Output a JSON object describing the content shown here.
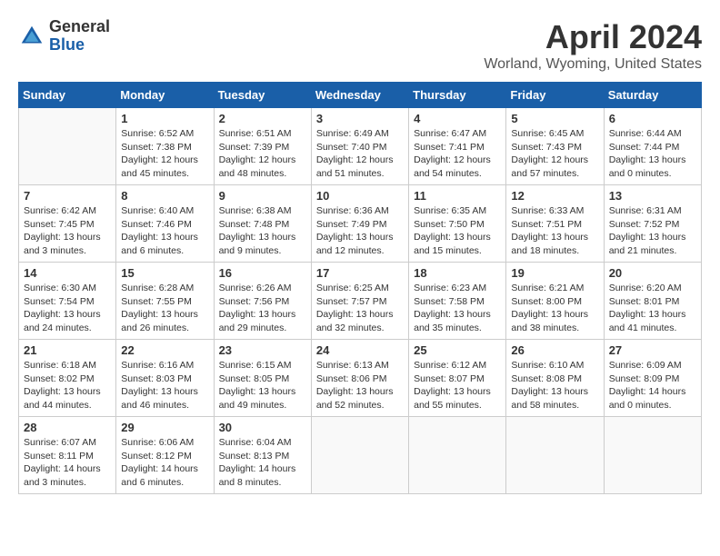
{
  "header": {
    "logo": {
      "line1": "General",
      "line2": "Blue"
    },
    "title": "April 2024",
    "subtitle": "Worland, Wyoming, United States"
  },
  "calendar": {
    "days_of_week": [
      "Sunday",
      "Monday",
      "Tuesday",
      "Wednesday",
      "Thursday",
      "Friday",
      "Saturday"
    ],
    "weeks": [
      [
        {
          "day": "",
          "info": ""
        },
        {
          "day": "1",
          "info": "Sunrise: 6:52 AM\nSunset: 7:38 PM\nDaylight: 12 hours\nand 45 minutes."
        },
        {
          "day": "2",
          "info": "Sunrise: 6:51 AM\nSunset: 7:39 PM\nDaylight: 12 hours\nand 48 minutes."
        },
        {
          "day": "3",
          "info": "Sunrise: 6:49 AM\nSunset: 7:40 PM\nDaylight: 12 hours\nand 51 minutes."
        },
        {
          "day": "4",
          "info": "Sunrise: 6:47 AM\nSunset: 7:41 PM\nDaylight: 12 hours\nand 54 minutes."
        },
        {
          "day": "5",
          "info": "Sunrise: 6:45 AM\nSunset: 7:43 PM\nDaylight: 12 hours\nand 57 minutes."
        },
        {
          "day": "6",
          "info": "Sunrise: 6:44 AM\nSunset: 7:44 PM\nDaylight: 13 hours\nand 0 minutes."
        }
      ],
      [
        {
          "day": "7",
          "info": "Sunrise: 6:42 AM\nSunset: 7:45 PM\nDaylight: 13 hours\nand 3 minutes."
        },
        {
          "day": "8",
          "info": "Sunrise: 6:40 AM\nSunset: 7:46 PM\nDaylight: 13 hours\nand 6 minutes."
        },
        {
          "day": "9",
          "info": "Sunrise: 6:38 AM\nSunset: 7:48 PM\nDaylight: 13 hours\nand 9 minutes."
        },
        {
          "day": "10",
          "info": "Sunrise: 6:36 AM\nSunset: 7:49 PM\nDaylight: 13 hours\nand 12 minutes."
        },
        {
          "day": "11",
          "info": "Sunrise: 6:35 AM\nSunset: 7:50 PM\nDaylight: 13 hours\nand 15 minutes."
        },
        {
          "day": "12",
          "info": "Sunrise: 6:33 AM\nSunset: 7:51 PM\nDaylight: 13 hours\nand 18 minutes."
        },
        {
          "day": "13",
          "info": "Sunrise: 6:31 AM\nSunset: 7:52 PM\nDaylight: 13 hours\nand 21 minutes."
        }
      ],
      [
        {
          "day": "14",
          "info": "Sunrise: 6:30 AM\nSunset: 7:54 PM\nDaylight: 13 hours\nand 24 minutes."
        },
        {
          "day": "15",
          "info": "Sunrise: 6:28 AM\nSunset: 7:55 PM\nDaylight: 13 hours\nand 26 minutes."
        },
        {
          "day": "16",
          "info": "Sunrise: 6:26 AM\nSunset: 7:56 PM\nDaylight: 13 hours\nand 29 minutes."
        },
        {
          "day": "17",
          "info": "Sunrise: 6:25 AM\nSunset: 7:57 PM\nDaylight: 13 hours\nand 32 minutes."
        },
        {
          "day": "18",
          "info": "Sunrise: 6:23 AM\nSunset: 7:58 PM\nDaylight: 13 hours\nand 35 minutes."
        },
        {
          "day": "19",
          "info": "Sunrise: 6:21 AM\nSunset: 8:00 PM\nDaylight: 13 hours\nand 38 minutes."
        },
        {
          "day": "20",
          "info": "Sunrise: 6:20 AM\nSunset: 8:01 PM\nDaylight: 13 hours\nand 41 minutes."
        }
      ],
      [
        {
          "day": "21",
          "info": "Sunrise: 6:18 AM\nSunset: 8:02 PM\nDaylight: 13 hours\nand 44 minutes."
        },
        {
          "day": "22",
          "info": "Sunrise: 6:16 AM\nSunset: 8:03 PM\nDaylight: 13 hours\nand 46 minutes."
        },
        {
          "day": "23",
          "info": "Sunrise: 6:15 AM\nSunset: 8:05 PM\nDaylight: 13 hours\nand 49 minutes."
        },
        {
          "day": "24",
          "info": "Sunrise: 6:13 AM\nSunset: 8:06 PM\nDaylight: 13 hours\nand 52 minutes."
        },
        {
          "day": "25",
          "info": "Sunrise: 6:12 AM\nSunset: 8:07 PM\nDaylight: 13 hours\nand 55 minutes."
        },
        {
          "day": "26",
          "info": "Sunrise: 6:10 AM\nSunset: 8:08 PM\nDaylight: 13 hours\nand 58 minutes."
        },
        {
          "day": "27",
          "info": "Sunrise: 6:09 AM\nSunset: 8:09 PM\nDaylight: 14 hours\nand 0 minutes."
        }
      ],
      [
        {
          "day": "28",
          "info": "Sunrise: 6:07 AM\nSunset: 8:11 PM\nDaylight: 14 hours\nand 3 minutes."
        },
        {
          "day": "29",
          "info": "Sunrise: 6:06 AM\nSunset: 8:12 PM\nDaylight: 14 hours\nand 6 minutes."
        },
        {
          "day": "30",
          "info": "Sunrise: 6:04 AM\nSunset: 8:13 PM\nDaylight: 14 hours\nand 8 minutes."
        },
        {
          "day": "",
          "info": ""
        },
        {
          "day": "",
          "info": ""
        },
        {
          "day": "",
          "info": ""
        },
        {
          "day": "",
          "info": ""
        }
      ]
    ]
  }
}
